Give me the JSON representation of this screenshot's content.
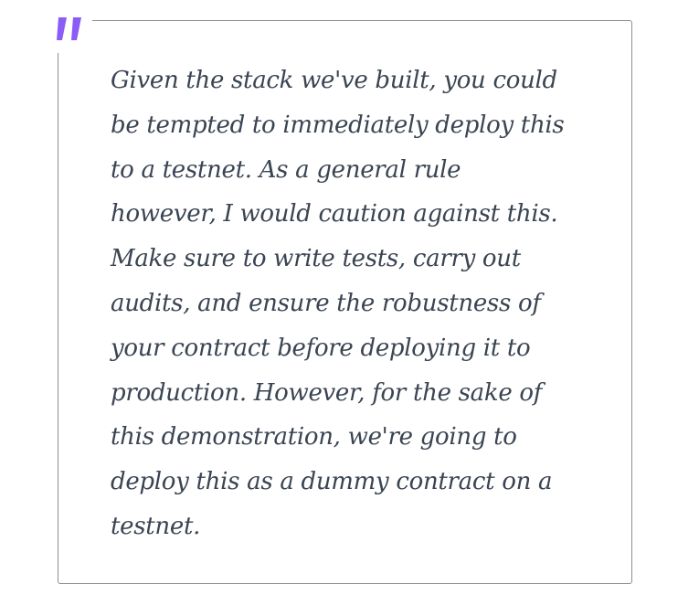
{
  "blockquote": {
    "icon": "quote-mark-icon",
    "accent_color": "#8b5cf6",
    "text_color": "#3a4452",
    "border_color": "#8a8f96",
    "lines": [
      "Given the stack we've built, you could",
      "be tempted to immediately deploy this",
      "to a testnet. As a general rule",
      "however, I would caution against this.",
      "Make sure to write tests, carry out",
      "audits, and ensure the robustness of",
      "your contract before deploying it to",
      "production. However, for the sake of",
      "this demonstration, we're going to",
      "deploy this as a dummy contract on a",
      "testnet."
    ]
  }
}
